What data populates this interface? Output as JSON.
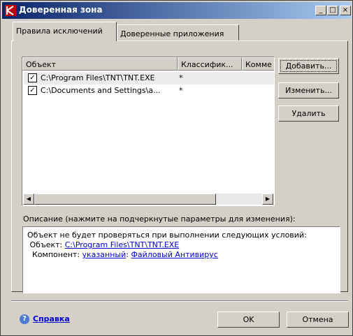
{
  "window": {
    "title": "Доверенная зона",
    "minimize": "_",
    "maximize": "□",
    "close": "×"
  },
  "tabs": [
    {
      "label": "Правила исключений",
      "active": true
    },
    {
      "label": "Доверенные приложения",
      "active": false
    }
  ],
  "list": {
    "columns": [
      "Объект",
      "Классифик...",
      "Комме"
    ],
    "rows": [
      {
        "checked": true,
        "object": "C:\\Program Files\\TNT\\TNT.EXE",
        "classification": "*"
      },
      {
        "checked": true,
        "object": "C:\\Documents and Settings\\a...",
        "classification": "*"
      }
    ]
  },
  "buttons": {
    "add": "Добавить...",
    "edit": "Изменить...",
    "delete": "Удалить"
  },
  "description": {
    "label": "Описание (нажмите на подчеркнутые параметры для изменения):",
    "line1": "Объект не будет проверяться при выполнении следующих условий:",
    "object_label": "Объект: ",
    "object_value": "C:\\Program Files\\TNT\\TNT.EXE",
    "component_label": "Компонент: ",
    "component_value1": "указанный",
    "component_sep": ": ",
    "component_value2": "Файловый Антивирус"
  },
  "footer": {
    "help": "Справка",
    "ok": "OK",
    "cancel": "Отмена"
  },
  "colors": {
    "accent": "#0a246a",
    "link": "#0000cc",
    "face": "#d4d0c8"
  }
}
